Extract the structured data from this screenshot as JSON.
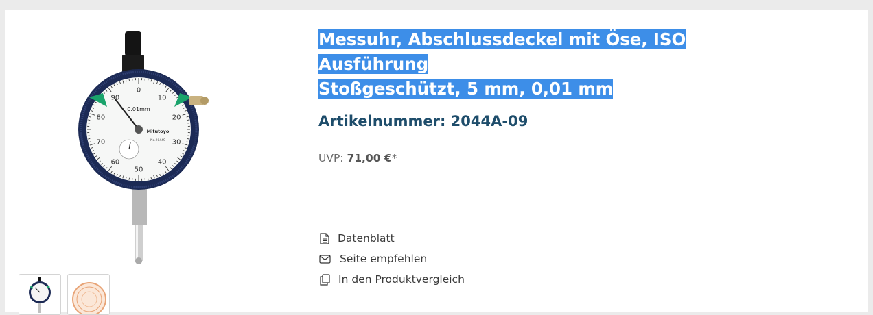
{
  "product": {
    "title_line1": "Messuhr, Abschlussdeckel mit Öse, ISO",
    "title_line2": "Ausführung",
    "title_line3": "Stoßgeschützt, 5 mm, 0,01 mm",
    "sku_label": "Artikelnummer:",
    "sku_value": "2044A-09",
    "price_label": "UVP:",
    "price_value": "71,00 €",
    "price_suffix": "*"
  },
  "gauge": {
    "brand": "Mitutoyo",
    "resolution": "0.01mm",
    "model": "No.2044S",
    "dial_numbers": [
      "0",
      "10",
      "20",
      "30",
      "40",
      "50",
      "60",
      "70",
      "80",
      "90"
    ]
  },
  "actions": [
    {
      "label": "Datenblatt",
      "icon": "document-icon"
    },
    {
      "label": "Seite empfehlen",
      "icon": "envelope-icon"
    },
    {
      "label": "In den Produktvergleich",
      "icon": "compare-icon"
    }
  ],
  "colors": {
    "page_bg": "#ebebeb",
    "selection": "#3d8ee8",
    "sku_text": "#1e4d6b",
    "pointer_green": "#1aa36b",
    "bezel": "#1c2a55"
  }
}
